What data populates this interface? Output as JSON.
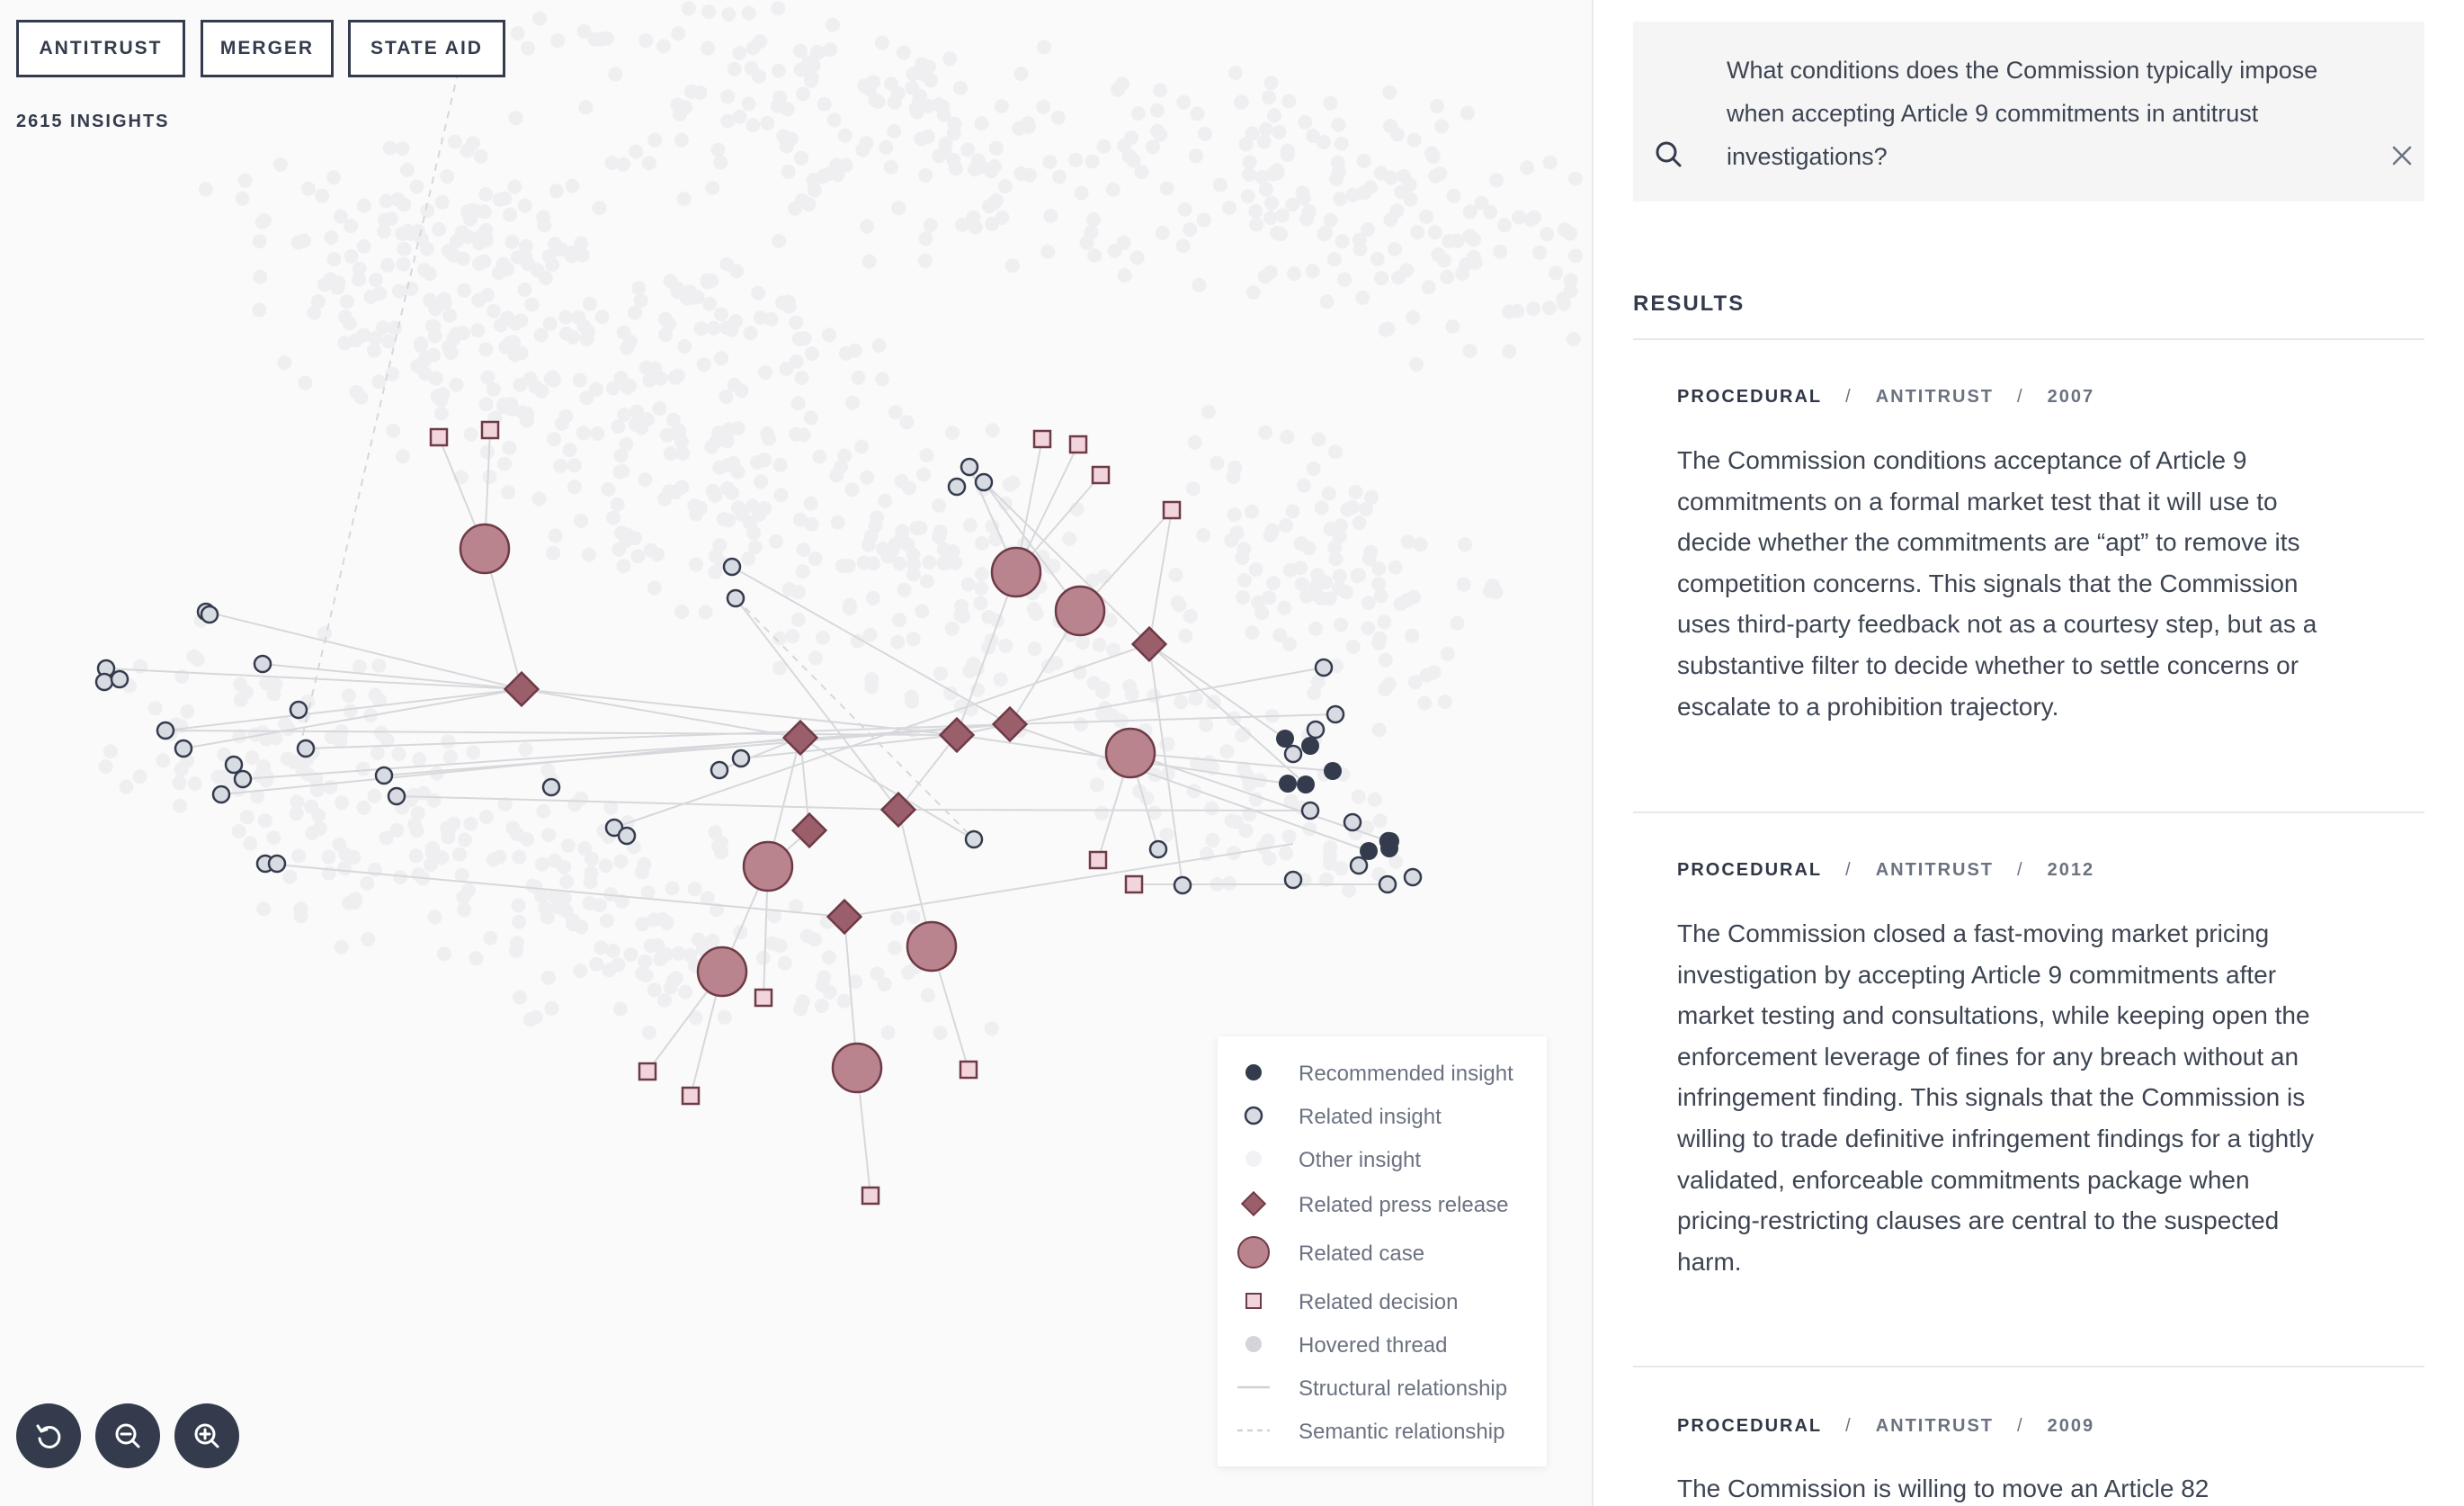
{
  "filters": [
    {
      "label": "ANTITRUST",
      "active": true
    },
    {
      "label": "MERGER",
      "active": false
    },
    {
      "label": "STATE AID",
      "active": false
    }
  ],
  "insight_count": "2615 INSIGHTS",
  "legend": [
    {
      "label": "Recommended insight",
      "icon": "filled-dark-circle"
    },
    {
      "label": "Related insight",
      "icon": "outlined-circle"
    },
    {
      "label": "Other insight",
      "icon": "faint-circle"
    },
    {
      "label": "Related press release",
      "icon": "diamond"
    },
    {
      "label": "Related case",
      "icon": "large-circle"
    },
    {
      "label": "Related decision",
      "icon": "square"
    },
    {
      "label": "Hovered thread",
      "icon": "grey-circle"
    },
    {
      "label": "Structural relationship",
      "icon": "solid-line"
    },
    {
      "label": "Semantic relationship",
      "icon": "dashed-line"
    }
  ],
  "colors": {
    "dark": "#333b4c",
    "case_fill": "#b9848e",
    "diamond_fill": "#9b5e6b",
    "decision_fill": "#f2d5dc",
    "insight_fill": "#d9dbe3",
    "accent_rose": "#6e3a46"
  },
  "search": {
    "query": "What conditions does the Commission typically impose when accepting Article 9 commitments in antitrust investigations?"
  },
  "results_title": "RESULTS",
  "results": [
    {
      "category": "PROCEDURAL",
      "domain": "ANTITRUST",
      "year": "2007",
      "text": "The Commission conditions acceptance of Article 9 commitments on a formal market test that it will use to decide whether the commitments are “apt” to remove its competition concerns. This signals that the Commission uses third-party feedback not as a courtesy step, but as a substantive filter to decide whether to settle concerns or escalate to a prohibition trajectory."
    },
    {
      "category": "PROCEDURAL",
      "domain": "ANTITRUST",
      "year": "2012",
      "text": "The Commission closed a fast-moving market pricing investigation by accepting Article 9 commitments after market testing and consultations, while keeping open the enforcement leverage of fines for any breach without an infringement finding. This signals that the Commission is willing to trade definitive infringement findings for a tightly validated, enforceable commitments package when pricing-restricting clauses are central to the suspected harm."
    },
    {
      "category": "PROCEDURAL",
      "domain": "ANTITRUST",
      "year": "2009",
      "text": "The Commission is willing to move an Article 82"
    }
  ],
  "graph": {
    "cases": [
      [
        539,
        610
      ],
      [
        1130,
        636
      ],
      [
        1201,
        679
      ],
      [
        1257,
        837
      ],
      [
        854,
        963
      ],
      [
        803,
        1080
      ],
      [
        1036,
        1052
      ],
      [
        953,
        1187
      ]
    ],
    "diamonds": [
      [
        580,
        766
      ],
      [
        1278,
        716
      ],
      [
        890,
        820
      ],
      [
        1064,
        817
      ],
      [
        1123,
        805
      ],
      [
        999,
        900
      ],
      [
        900,
        923
      ],
      [
        939,
        1019
      ]
    ],
    "decisions": [
      [
        488,
        486
      ],
      [
        545,
        478
      ],
      [
        1159,
        488
      ],
      [
        1199,
        494
      ],
      [
        1224,
        528
      ],
      [
        1303,
        567
      ],
      [
        1221,
        956
      ],
      [
        1261,
        983
      ],
      [
        849,
        1109
      ],
      [
        720,
        1191
      ],
      [
        768,
        1218
      ],
      [
        1077,
        1189
      ],
      [
        968,
        1329
      ]
    ],
    "related_insights": [
      [
        229,
        680
      ],
      [
        233,
        683
      ],
      [
        118,
        743
      ],
      [
        116,
        758
      ],
      [
        133,
        755
      ],
      [
        292,
        738
      ],
      [
        332,
        789
      ],
      [
        184,
        812
      ],
      [
        204,
        832
      ],
      [
        340,
        832
      ],
      [
        270,
        866
      ],
      [
        260,
        850
      ],
      [
        246,
        883
      ],
      [
        427,
        862
      ],
      [
        441,
        885
      ],
      [
        613,
        875
      ],
      [
        683,
        920
      ],
      [
        697,
        929
      ],
      [
        295,
        960
      ],
      [
        308,
        960
      ],
      [
        814,
        630
      ],
      [
        818,
        665
      ],
      [
        800,
        856
      ],
      [
        824,
        843
      ],
      [
        1083,
        933
      ],
      [
        1288,
        944
      ],
      [
        1315,
        984
      ],
      [
        1078,
        519
      ],
      [
        1064,
        541
      ],
      [
        1094,
        536
      ],
      [
        1472,
        742
      ],
      [
        1485,
        794
      ],
      [
        1463,
        811
      ],
      [
        1438,
        838
      ],
      [
        1457,
        901
      ],
      [
        1504,
        914
      ],
      [
        1544,
        935
      ],
      [
        1511,
        962
      ],
      [
        1438,
        978
      ],
      [
        1543,
        983
      ],
      [
        1571,
        975
      ]
    ],
    "recommended": [
      [
        1429,
        821
      ],
      [
        1457,
        829
      ],
      [
        1482,
        857
      ],
      [
        1432,
        871
      ],
      [
        1452,
        872
      ],
      [
        1522,
        946
      ],
      [
        1546,
        935
      ],
      [
        1545,
        943
      ]
    ],
    "edges": [
      [
        229,
        680,
        580,
        766
      ],
      [
        118,
        743,
        580,
        766
      ],
      [
        184,
        812,
        580,
        766
      ],
      [
        204,
        832,
        580,
        766
      ],
      [
        292,
        738,
        580,
        766
      ],
      [
        488,
        486,
        539,
        610
      ],
      [
        545,
        478,
        539,
        610
      ],
      [
        539,
        610,
        580,
        766
      ],
      [
        580,
        766,
        890,
        820
      ],
      [
        580,
        766,
        1064,
        817
      ],
      [
        184,
        812,
        1064,
        817
      ],
      [
        246,
        883,
        890,
        820
      ],
      [
        270,
        866,
        1123,
        805
      ],
      [
        340,
        832,
        1123,
        805
      ],
      [
        297,
        960,
        939,
        1019
      ],
      [
        427,
        862,
        1123,
        805
      ],
      [
        441,
        885,
        999,
        900
      ],
      [
        683,
        920,
        1278,
        716
      ],
      [
        814,
        630,
        1123,
        805
      ],
      [
        818,
        665,
        999,
        900
      ],
      [
        800,
        856,
        890,
        820
      ],
      [
        824,
        843,
        1064,
        817
      ],
      [
        1130,
        636,
        1064,
        817
      ],
      [
        1201,
        679,
        1123,
        805
      ],
      [
        1159,
        488,
        1130,
        636
      ],
      [
        1199,
        494,
        1130,
        636
      ],
      [
        1224,
        528,
        1130,
        636
      ],
      [
        1303,
        567,
        1278,
        716
      ],
      [
        1303,
        567,
        1201,
        679
      ],
      [
        1078,
        519,
        1130,
        636
      ],
      [
        1094,
        536,
        1201,
        679
      ],
      [
        1094,
        536,
        1278,
        716
      ],
      [
        1123,
        805,
        1472,
        742
      ],
      [
        1123,
        805,
        1485,
        794
      ],
      [
        1064,
        817,
        1432,
        871
      ],
      [
        999,
        900,
        1457,
        901
      ],
      [
        1123,
        805,
        1522,
        946
      ],
      [
        1278,
        716,
        1452,
        872
      ],
      [
        1278,
        716,
        1429,
        821
      ],
      [
        1257,
        837,
        1544,
        935
      ],
      [
        1257,
        837,
        1482,
        857
      ],
      [
        1257,
        837,
        1221,
        956
      ],
      [
        1257,
        837,
        1288,
        944
      ],
      [
        1261,
        983,
        1543,
        983
      ],
      [
        939,
        1019,
        1438,
        938
      ],
      [
        1083,
        933,
        890,
        820
      ],
      [
        1315,
        984,
        1278,
        716
      ],
      [
        890,
        820,
        854,
        963
      ],
      [
        900,
        923,
        854,
        963
      ],
      [
        854,
        963,
        849,
        1109
      ],
      [
        854,
        963,
        803,
        1080
      ],
      [
        803,
        1080,
        720,
        1191
      ],
      [
        803,
        1080,
        768,
        1218
      ],
      [
        939,
        1019,
        953,
        1187
      ],
      [
        953,
        1187,
        968,
        1329
      ],
      [
        999,
        900,
        1036,
        1052
      ],
      [
        1036,
        1052,
        1077,
        1189
      ],
      [
        890,
        820,
        900,
        923
      ],
      [
        1064,
        817,
        999,
        900
      ],
      [
        1123,
        805,
        1064,
        817
      ]
    ],
    "dashed": [
      [
        513,
        65,
        336,
        820
      ],
      [
        818,
        665,
        1083,
        933
      ]
    ]
  }
}
